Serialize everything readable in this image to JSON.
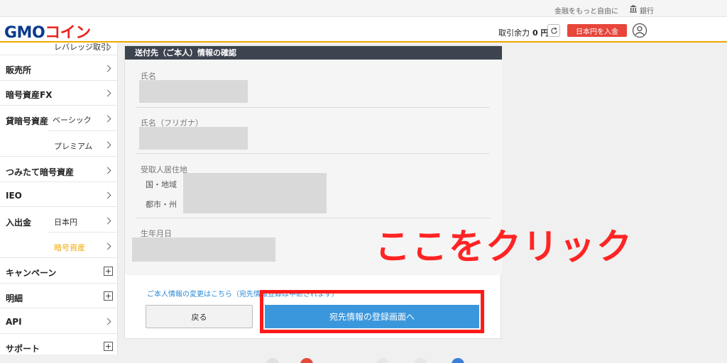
{
  "topbar": {
    "tagline": "金融をもっと自由に",
    "bank_label": "銀行"
  },
  "header": {
    "logo_gmo": "GMO",
    "logo_coin": "コイン",
    "balance_label": "取引余力",
    "balance_value": "0 円",
    "deposit_button": "日本円を入金"
  },
  "sidebar": {
    "items": [
      {
        "label": "レバレッジ取引"
      },
      {
        "label": "販売所"
      },
      {
        "label": "暗号資産FX"
      },
      {
        "label": "貸暗号資産",
        "subs": [
          "ベーシック",
          "プレミアム"
        ]
      },
      {
        "label": "つみたて暗号資産"
      },
      {
        "label": "IEO"
      },
      {
        "label": "入出金",
        "subs": [
          "日本円",
          "暗号資産"
        ]
      },
      {
        "label": "キャンペーン"
      },
      {
        "label": "明細"
      },
      {
        "label": "API"
      },
      {
        "label": "サポート"
      }
    ]
  },
  "form": {
    "title": "送付先（ご本人）情報の確認",
    "name_label": "氏名",
    "kana_label": "氏名（フリガナ）",
    "address_label": "受取人居住地",
    "country_label": "国・地域",
    "city_label": "都市・州",
    "dob_label": "生年月日",
    "change_link": "ご本人情報の変更はこちら（宛先情報登録は中断されます）",
    "back_button": "戻る",
    "next_button": "宛先情報の登録画面へ"
  },
  "annotation": {
    "callout": "ここをクリック",
    "color": "#ff2424"
  },
  "colors": {
    "accent": "#f0a800",
    "deposit": "#e8453b",
    "primary_button": "#3b97dc",
    "active_sidebar": "#f0a800"
  }
}
